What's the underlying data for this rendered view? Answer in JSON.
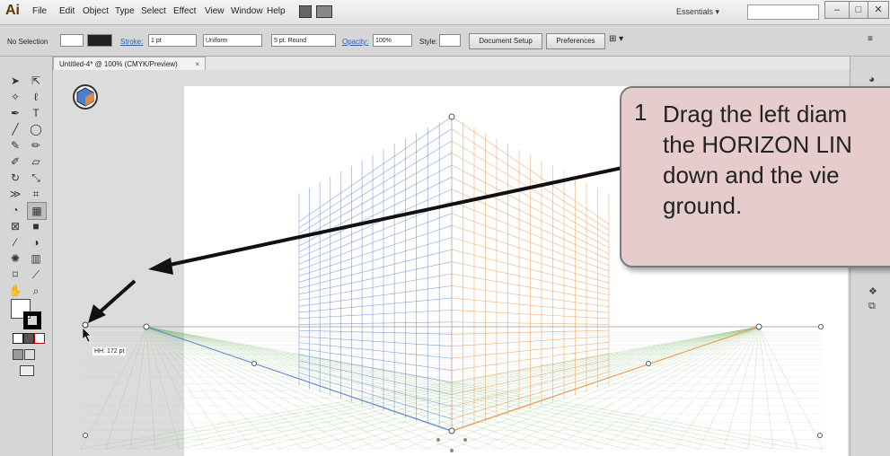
{
  "app": {
    "logo": "Ai",
    "menus": [
      "File",
      "Edit",
      "Object",
      "Type",
      "Select",
      "Effect",
      "View",
      "Window",
      "Help"
    ],
    "workspace": "Essentials",
    "window_buttons": [
      "–",
      "□",
      "✕"
    ]
  },
  "control_bar": {
    "selection": "No Selection",
    "stroke_label": "Stroke:",
    "stroke_value": "1 pt",
    "profile": "Uniform",
    "brush": "5 pt. Round",
    "opacity_label": "Opacity:",
    "opacity_value": "100%",
    "style_label": "Style:",
    "doc_setup": "Document Setup",
    "preferences": "Preferences"
  },
  "document": {
    "tab_title": "Untitled-4* @ 100% (CMYK/Preview)",
    "tab_close": "×",
    "hh_readout": "HH: 172 pt"
  },
  "callout": {
    "number": "1",
    "text": "Drag the left diam\nthe HORIZON LIN\ndown and the vie\nground."
  },
  "icons": {
    "tools": [
      "selection-tool-icon",
      "direct-selection-tool-icon",
      "magic-wand-icon",
      "lasso-icon",
      "pen-tool-icon",
      "type-tool-icon",
      "line-tool-icon",
      "ellipse-tool-icon",
      "paintbrush-icon",
      "pencil-icon",
      "blob-brush-icon",
      "eraser-icon",
      "rotate-icon",
      "scale-icon",
      "width-tool-icon",
      "free-transform-icon",
      "shape-builder-icon",
      "perspective-grid-icon",
      "mesh-icon",
      "gradient-icon",
      "eyedropper-icon",
      "blend-icon",
      "symbol-sprayer-icon",
      "column-graph-icon",
      "artboard-icon",
      "slice-icon",
      "hand-icon",
      "zoom-icon"
    ]
  },
  "colors": {
    "callout_fill": "#e6cccc",
    "grid_left": "#6a8fd0",
    "grid_right": "#e9a05a",
    "grid_ground": "#7dbb6a"
  }
}
